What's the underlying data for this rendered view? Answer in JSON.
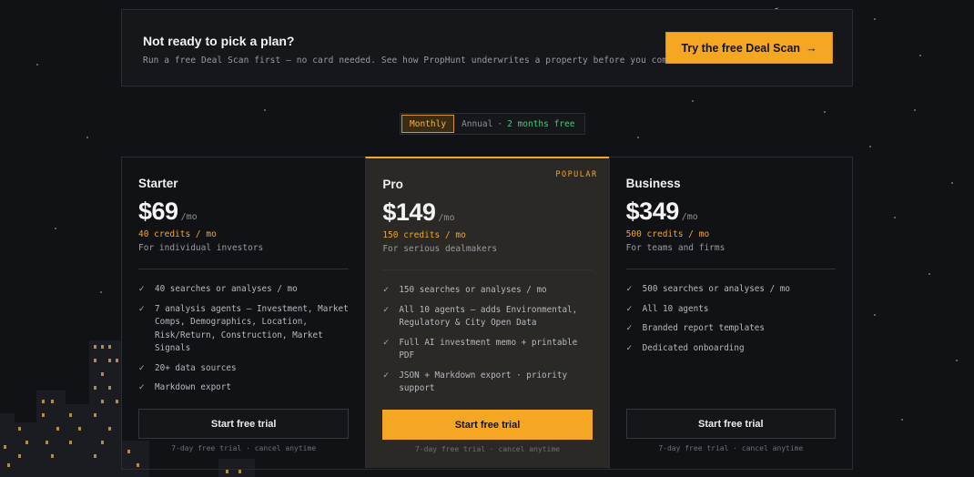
{
  "banner": {
    "title": "Not ready to pick a plan?",
    "subtitle": "Run a free Deal Scan first — no card needed. See how PropHunt underwrites a property before you commit.",
    "cta_label": "Try the free Deal Scan",
    "cta_icon": "arrow-right-icon"
  },
  "billing_toggle": {
    "monthly_label": "Monthly",
    "annual_label": "Annual",
    "separator": "·",
    "annual_promo": "2 months free",
    "selected": "Monthly"
  },
  "plans": [
    {
      "name": "Starter",
      "price": "$69",
      "period": "/mo",
      "credits": "40 credits / mo",
      "tagline": "For individual investors",
      "badge": "",
      "features": [
        "40 searches or analyses / mo",
        "7 analysis agents — Investment, Market Comps, Demographics, Location, Risk/Return, Construction, Market Signals",
        "20+ data sources",
        "Markdown export"
      ],
      "cta_label": "Start free trial",
      "fine_print": "7-day free trial · cancel anytime"
    },
    {
      "name": "Pro",
      "price": "$149",
      "period": "/mo",
      "credits": "150 credits / mo",
      "tagline": "For serious dealmakers",
      "badge": "POPULAR",
      "features": [
        "150 searches or analyses / mo",
        "All 10 agents — adds Environmental, Regulatory & City Open Data",
        "Full AI investment memo + printable PDF",
        "JSON + Markdown export · priority support"
      ],
      "cta_label": "Start free trial",
      "fine_print": "7-day free trial · cancel anytime"
    },
    {
      "name": "Business",
      "price": "$349",
      "period": "/mo",
      "credits": "500 credits / mo",
      "tagline": "For teams and firms",
      "badge": "",
      "features": [
        "500 searches or analyses / mo",
        "All 10 agents",
        "Branded report templates",
        "Dedicated onboarding"
      ],
      "cta_label": "Start free trial",
      "fine_print": "7-day free trial · cancel anytime"
    }
  ],
  "colors": {
    "accent": "#f5a623",
    "background": "#111215",
    "promo_green": "#47c97c"
  }
}
